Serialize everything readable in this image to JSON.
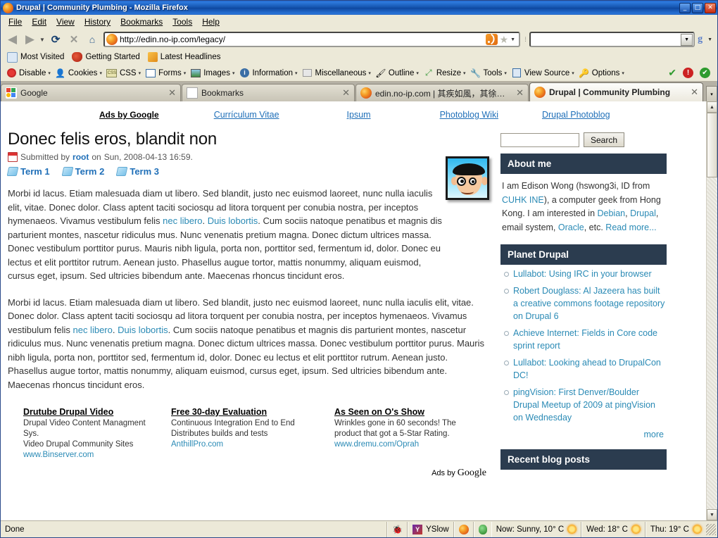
{
  "window": {
    "title": "Drupal | Community Plumbing - Mozilla Firefox",
    "app_icon": "firefox-icon",
    "minimize": "_",
    "maximize": "□",
    "close": "✕"
  },
  "menubar": {
    "items": [
      {
        "label": "File",
        "name": "menu-file"
      },
      {
        "label": "Edit",
        "name": "menu-edit"
      },
      {
        "label": "View",
        "name": "menu-view"
      },
      {
        "label": "History",
        "name": "menu-history"
      },
      {
        "label": "Bookmarks",
        "name": "menu-bookmarks"
      },
      {
        "label": "Tools",
        "name": "menu-tools"
      },
      {
        "label": "Help",
        "name": "menu-help"
      }
    ]
  },
  "navbar": {
    "back_icon": "◀",
    "forward_icon": "▶",
    "dropdown_icon": "▼",
    "reload_icon": "⟳",
    "stop_icon": "✕",
    "home_icon": "⌂",
    "url": "http://edin.no-ip.com/legacy/",
    "url_placeholder": "",
    "feed_icon": "rss-icon",
    "star_icon": "★",
    "search_value": "",
    "search_placeholder": "",
    "search_engine_icon": "g",
    "go_caret": "▼"
  },
  "bookmarks_bar": {
    "items": [
      {
        "label": "Most Visited",
        "icon": "most-visited-icon"
      },
      {
        "label": "Getting Started",
        "icon": "getting-started-icon"
      },
      {
        "label": "Latest Headlines",
        "icon": "rss-icon"
      }
    ]
  },
  "devtoolbar": {
    "items": [
      {
        "label": "Disable",
        "icon": "disable-icon",
        "caret": "▾"
      },
      {
        "label": "Cookies",
        "icon": "cookies-icon",
        "caret": "▾"
      },
      {
        "label": "CSS",
        "icon": "css-icon",
        "caret": "▾"
      },
      {
        "label": "Forms",
        "icon": "forms-icon",
        "caret": "▾"
      },
      {
        "label": "Images",
        "icon": "images-icon",
        "caret": "▾"
      },
      {
        "label": "Information",
        "icon": "information-icon",
        "caret": "▾"
      },
      {
        "label": "Miscellaneous",
        "icon": "miscellaneous-icon",
        "caret": "▾"
      },
      {
        "label": "Outline",
        "icon": "outline-icon",
        "caret": "▾"
      },
      {
        "label": "Resize",
        "icon": "resize-icon",
        "caret": "▾"
      },
      {
        "label": "Tools",
        "icon": "tools-icon",
        "caret": "▾"
      },
      {
        "label": "View Source",
        "icon": "view-source-icon",
        "caret": "▾"
      },
      {
        "label": "Options",
        "icon": "options-icon",
        "caret": "▾"
      }
    ],
    "status_icons": [
      {
        "name": "validation-pass-icon",
        "glyph": "✔",
        "color": "#2e9b2e"
      },
      {
        "name": "validation-error-icon",
        "glyph": "!",
        "color": "#cc2222"
      },
      {
        "name": "validation-ok-icon",
        "glyph": "✔",
        "color": "#2e9b2e"
      }
    ]
  },
  "tabs": {
    "items": [
      {
        "label": "Google",
        "icon": "google-favicon",
        "active": false,
        "close": "✕"
      },
      {
        "label": "Bookmarks",
        "icon": "document-favicon",
        "active": false,
        "close": "✕"
      },
      {
        "label": "edin.no-ip.com | 其疾如風，其徐如林...",
        "icon": "firefox-favicon",
        "active": false,
        "close": "✕"
      },
      {
        "label": "Drupal | Community Plumbing",
        "icon": "firefox-favicon",
        "active": true,
        "close": "✕"
      }
    ],
    "list_all_icon": "▾"
  },
  "page": {
    "topnav": [
      {
        "label": "Ads by Google",
        "name": "ads-by-google-link",
        "bold": true
      },
      {
        "label": "Currículum Vitae",
        "name": "nav-curriculum-vitae"
      },
      {
        "label": "Ipsum",
        "name": "nav-ipsum"
      },
      {
        "label": "Photoblog Wiki",
        "name": "nav-photoblog-wiki"
      },
      {
        "label": "Drupal Photoblog",
        "name": "nav-drupal-photoblog"
      }
    ],
    "node": {
      "title": "Donec felis eros, blandit non",
      "submitted_prefix": "Submitted by",
      "submitted_author": "root",
      "submitted_middle": "on",
      "submitted_date": "Sun, 2008-04-13 16:59.",
      "terms": [
        "Term 1",
        "Term 2",
        "Term 3"
      ],
      "paragraph1_a": "Morbi id lacus. Etiam malesuada diam ut libero. Sed blandit, justo nec euismod laoreet, nunc nulla iaculis elit, vitae. Donec dolor. Class aptent taciti sociosqu ad litora torquent per conubia nostra, per inceptos hymenaeos. Vivamus vestibulum felis ",
      "paragraph1_link1": "nec libero",
      "paragraph1_b": ". ",
      "paragraph1_link2": "Duis lobortis",
      "paragraph1_c": ". Cum sociis natoque penatibus et magnis dis parturient montes, nascetur ridiculus mus. Nunc venenatis pretium magna. Donec dictum ultrices massa. Donec vestibulum porttitor purus. Mauris nibh ligula, porta non, porttitor sed, fermentum id, dolor. Donec eu lectus et elit porttitor rutrum. Aenean justo. Phasellus augue tortor, mattis nonummy, aliquam euismod, cursus eget, ipsum. Sed ultricies bibendum ante. Maecenas rhoncus tincidunt eros.",
      "paragraph2_a": "Morbi id lacus. Etiam malesuada diam ut libero. Sed blandit, justo nec euismod laoreet, nunc nulla iaculis elit, vitae. Donec dolor. Class aptent taciti sociosqu ad litora torquent per conubia nostra, per inceptos hymenaeos. Vivamus vestibulum felis ",
      "paragraph2_link1": "nec libero",
      "paragraph2_b": ". ",
      "paragraph2_link2": "Duis lobortis",
      "paragraph2_c": ". Cum sociis natoque penatibus et magnis dis parturient montes, nascetur ridiculus mus. Nunc venenatis pretium magna. Donec dictum ultrices massa. Donec vestibulum porttitor purus. Mauris nibh ligula, porta non, porttitor sed, fermentum id, dolor. Donec eu lectus et elit porttitor rutrum. Aenean justo. Phasellus augue tortor, mattis nonummy, aliquam euismod, cursus eget, ipsum. Sed ultricies bibendum ante. Maecenas rhoncus tincidunt eros."
    },
    "ads": {
      "items": [
        {
          "title": "Drutube Drupal Video",
          "line1": "Drupal Video Content Managment Sys.",
          "line2": "Video Drupal Community Sites",
          "url": "www.Binserver.com"
        },
        {
          "title": "Free 30-day Evaluation",
          "line1": "Continuous Integration End to End",
          "line2": "Distributes builds and tests",
          "url": "AnthillPro.com"
        },
        {
          "title": "As Seen on O's Show",
          "line1": "Wrinkles gone in 60 seconds! The",
          "line2": "product that got a 5-Star Rating.",
          "url": "www.dremu.com/Oprah"
        }
      ],
      "footer_label": "Ads by",
      "footer_brand": "Google"
    },
    "sidebar": {
      "search": {
        "value": "",
        "placeholder": "",
        "button_label": "Search"
      },
      "blocks": [
        {
          "title": "About me",
          "name": "block-about-me",
          "type": "text",
          "text_parts": [
            {
              "t": "I am Edison Wong (hswong3i, ID from ",
              "link": false
            },
            {
              "t": "CUHK INE",
              "link": true
            },
            {
              "t": "), a computer geek from Hong Kong. I am interested in ",
              "link": false
            },
            {
              "t": "Debian",
              "link": true
            },
            {
              "t": ", ",
              "link": false
            },
            {
              "t": "Drupal",
              "link": true
            },
            {
              "t": ", email system, ",
              "link": false
            },
            {
              "t": "Oracle",
              "link": true
            },
            {
              "t": ", etc. ",
              "link": false
            },
            {
              "t": "Read more...",
              "link": true
            }
          ]
        },
        {
          "title": "Planet Drupal",
          "name": "block-planet-drupal",
          "type": "list",
          "items": [
            "Lullabot: Using IRC in your browser",
            "Robert Douglass: Al Jazeera has built a creative commons footage repository on Drupal 6",
            "Achieve Internet: Fields in Core code sprint report",
            "Lullabot: Looking ahead to DrupalCon DC!",
            "pingVision: First Denver/Boulder Drupal Meetup of 2009 at pingVision on Wednesday"
          ],
          "more_label": "more"
        },
        {
          "title": "Recent blog posts",
          "name": "block-recent-blog-posts",
          "type": "list",
          "items": []
        }
      ]
    },
    "avatar_alt": "avatar-image",
    "accent_header_color": "#2b3c4f",
    "link_color": "#2a8ab5"
  },
  "statusbar": {
    "status_text": "Done",
    "items": [
      {
        "label": "YSlow",
        "icon": "yslow-icon",
        "name": "status-yslow"
      },
      {
        "label": "Now: Sunny, 10° C",
        "icon": "sun-icon",
        "name": "status-weather-now"
      },
      {
        "label": "Wed: 18° C",
        "icon": "sun-icon",
        "name": "status-weather-wed"
      },
      {
        "label": "Thu: 19° C",
        "icon": "sun-icon",
        "name": "status-weather-thu"
      }
    ]
  },
  "scrollbar": {
    "up_icon": "▲",
    "down_icon": "▼"
  }
}
